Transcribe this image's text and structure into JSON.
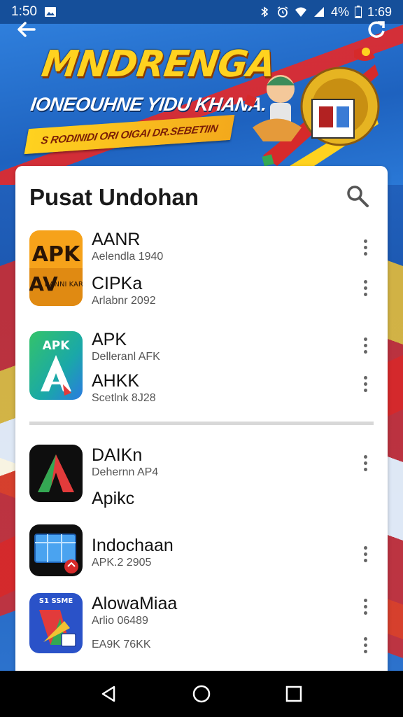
{
  "status_bar": {
    "time": "1:50",
    "battery": "4%",
    "clock_right": "1:69",
    "icons": [
      "gallery-icon",
      "bluetooth-icon",
      "alarm-icon",
      "wifi-icon",
      "signal-icon",
      "battery-icon"
    ]
  },
  "banner": {
    "title": "MNDRENGA",
    "subtitle": "IONEOUHNE YIDU KHANA.",
    "ribbon": "S RODINIDI ORI OIGAI DR.SEBETIIN",
    "back_icon": "back-arrow-icon",
    "refresh_icon": "refresh-icon"
  },
  "card": {
    "title": "Pusat Undohan",
    "search_icon": "search-icon",
    "groups": [
      {
        "icon_label": "APK",
        "icon_sub": "AV",
        "icon_caption": "BANNI KARAR",
        "entries": [
          {
            "name": "AANR",
            "meta": "Aelendla 1940"
          },
          {
            "name": "CIPKa",
            "meta": "Arlabnr 2092"
          }
        ]
      },
      {
        "icon_label": "APK",
        "entries": [
          {
            "name": "APK",
            "meta": "Delleranl AFK"
          },
          {
            "name": "AHKK",
            "meta": "Scetlnk 8J28"
          }
        ]
      },
      {
        "entries": [
          {
            "name": "DAIKn",
            "meta": "Dehernn AP4"
          },
          {
            "name": "Apikc",
            "meta": ""
          }
        ]
      },
      {
        "entries": [
          {
            "name": "Indochaan",
            "meta": "APK.2 2905"
          }
        ]
      },
      {
        "icon_label": "S1 SSME",
        "entries": [
          {
            "name": "AlowaMiaa",
            "meta": "Arlio 06489"
          },
          {
            "name": "",
            "meta": "EA9K 76KK"
          }
        ]
      }
    ],
    "more_icon": "more-vert-icon"
  },
  "nav_bar": {
    "back": "nav-back-icon",
    "home": "nav-home-icon",
    "recents": "nav-recents-icon"
  },
  "colors": {
    "status_bar": "#154f9a",
    "banner_yellow": "#ffd21f",
    "card_bg": "#ffffff",
    "accent_green": "#34a853",
    "accent_red": "#d62a2a"
  }
}
